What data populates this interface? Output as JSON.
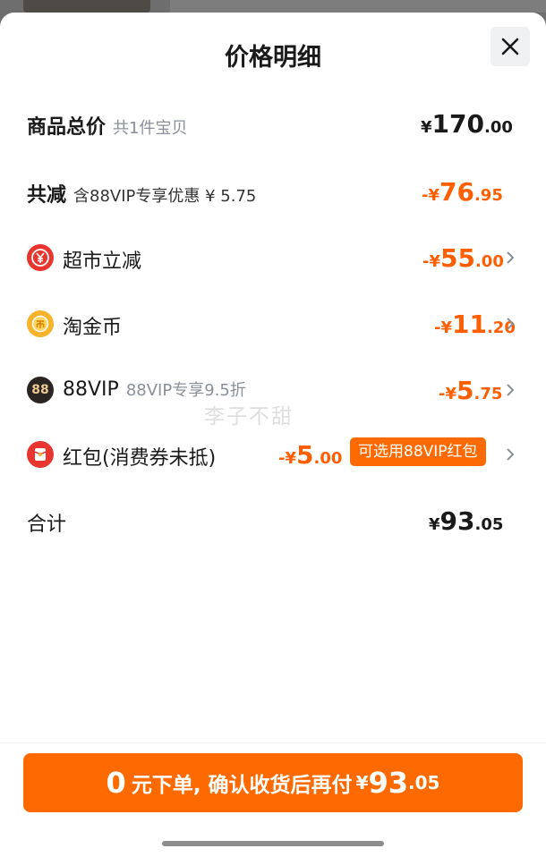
{
  "title": "价格明细",
  "close_icon": "close-icon",
  "watermark": "李子不甜",
  "rows": {
    "total": {
      "label": "商品总价",
      "sub": "共1件宝贝",
      "currency": "¥",
      "int": "170",
      "dec": ".00"
    },
    "discount": {
      "label": "共减",
      "sub": "含88VIP专享优惠 ¥ 5.75",
      "currency": "-¥",
      "int": "76",
      "dec": ".95"
    },
    "supermarket": {
      "label": "超市立减",
      "currency": "-¥",
      "int": "55",
      "dec": ".00",
      "icon": "yuan-badge-icon"
    },
    "coins": {
      "label": "淘金币",
      "currency": "-¥",
      "int": "11",
      "dec": ".20",
      "icon": "gold-coin-icon"
    },
    "vip": {
      "label": "88VIP",
      "sub": "88VIP专享9.5折",
      "currency": "-¥",
      "int": "5",
      "dec": ".75",
      "icon": "vip88-icon",
      "icon_text": "88"
    },
    "redpacket": {
      "label": "红包(消费券未抵)",
      "currency": "-¥",
      "int": "5",
      "dec": ".00",
      "pill": "可选用88VIP红包",
      "icon": "red-packet-icon"
    },
    "sum": {
      "label": "合计",
      "currency": "¥",
      "int": "93",
      "dec": ".05"
    }
  },
  "cta": {
    "zero": "0",
    "text": "元下单, 确认收货后再付",
    "currency": "¥",
    "int": "93",
    "dec": ".05"
  },
  "colors": {
    "accent": "#ff6a00",
    "discount_text": "#ff5f00",
    "muted": "#8a8f99"
  }
}
